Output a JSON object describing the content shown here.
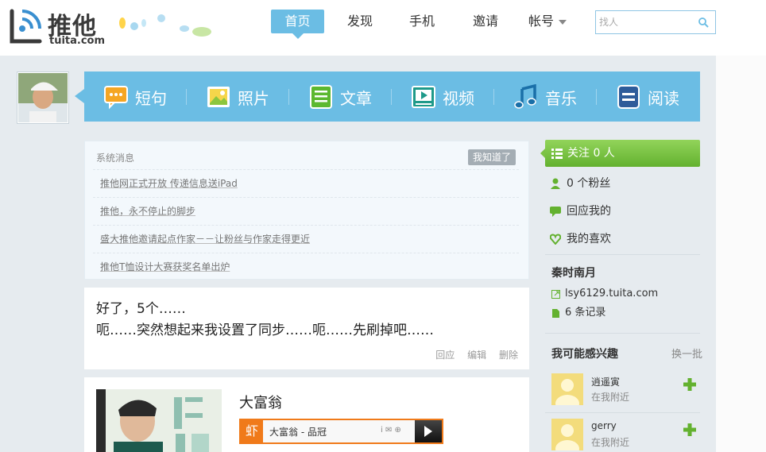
{
  "brand": {
    "cn": "推他",
    "en": "tuita.com"
  },
  "nav": {
    "items": [
      {
        "label": "首页",
        "active": true
      },
      {
        "label": "发现",
        "active": false
      },
      {
        "label": "手机",
        "active": false
      },
      {
        "label": "邀请",
        "active": false
      },
      {
        "label": "帐号",
        "active": false,
        "dropdown": true
      }
    ]
  },
  "search": {
    "placeholder": "找人",
    "icon": "search-icon"
  },
  "toolbar": {
    "items": [
      {
        "label": "短句",
        "icon": "speech-bubble-icon"
      },
      {
        "label": "照片",
        "icon": "photo-icon"
      },
      {
        "label": "文章",
        "icon": "article-icon"
      },
      {
        "label": "视频",
        "icon": "video-icon"
      },
      {
        "label": "音乐",
        "icon": "music-note-icon"
      },
      {
        "label": "阅读",
        "icon": "reading-icon"
      }
    ]
  },
  "notice": {
    "title": "系统消息",
    "dismiss_label": "我知道了",
    "items": [
      "推他网正式开放  传递信息送iPad",
      "推他，永不停止的脚步",
      "盛大推他邀请起点作家－－让粉丝与作家走得更近",
      "推他T恤设计大赛获奖名单出炉"
    ]
  },
  "post": {
    "line1": "好了，5个……",
    "line2": "呃……突然想起来我设置了同步……呃……先刷掉吧……",
    "actions": {
      "reply": "回应",
      "edit": "编辑",
      "delete": "删除"
    }
  },
  "music_post": {
    "title": "大富翁",
    "player": {
      "logo": "虾",
      "track": "大富翁 - 品冠",
      "icons": "i ✉ ⊕"
    }
  },
  "sidebar": {
    "follow_label": "关注 0 人",
    "fans_label": "0 个粉丝",
    "replies_label": "回应我的",
    "likes_label": "我的喜欢",
    "profile_name": "秦时南月",
    "profile_url": "lsy6129.tuita.com",
    "records_label": "6 条记录",
    "interest_title": "我可能感兴趣",
    "interest_refresh": "换一批",
    "suggestions": [
      {
        "name": "逍遥寅",
        "location": "在我附近"
      },
      {
        "name": "gerry",
        "location": "在我附近"
      }
    ]
  },
  "colors": {
    "accent_blue": "#6bbde4",
    "follow_green": "#7cc245",
    "player_orange": "#f07a1a",
    "page_bg": "#e6ebef"
  }
}
